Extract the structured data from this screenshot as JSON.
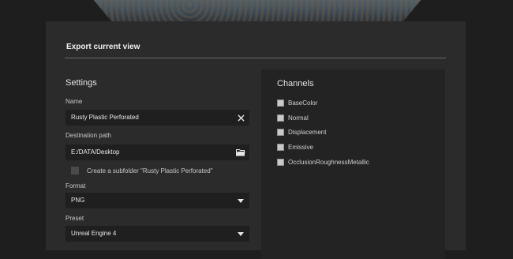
{
  "dialog": {
    "title": "Export current view"
  },
  "settings": {
    "heading": "Settings",
    "name_label": "Name",
    "name_value": "Rusty Plastic Perforated",
    "dest_label": "Destination path",
    "dest_value": "E:/DATA/Desktop",
    "subfolder_label": "Create a subfolder \"Rusty Plastic Perforated\"",
    "format_label": "Format",
    "format_value": "PNG",
    "preset_label": "Preset",
    "preset_value": "Unreal Engine 4"
  },
  "channels": {
    "heading": "Channels",
    "items": [
      {
        "label": "BaseColor"
      },
      {
        "label": "Normal"
      },
      {
        "label": "Displacement"
      },
      {
        "label": "Emissive"
      },
      {
        "label": "OcclusionRoughnessMetallic"
      }
    ]
  },
  "icons": {
    "clear": "close-icon",
    "browse": "folder-icon",
    "dropdown": "chevron-down-icon"
  }
}
